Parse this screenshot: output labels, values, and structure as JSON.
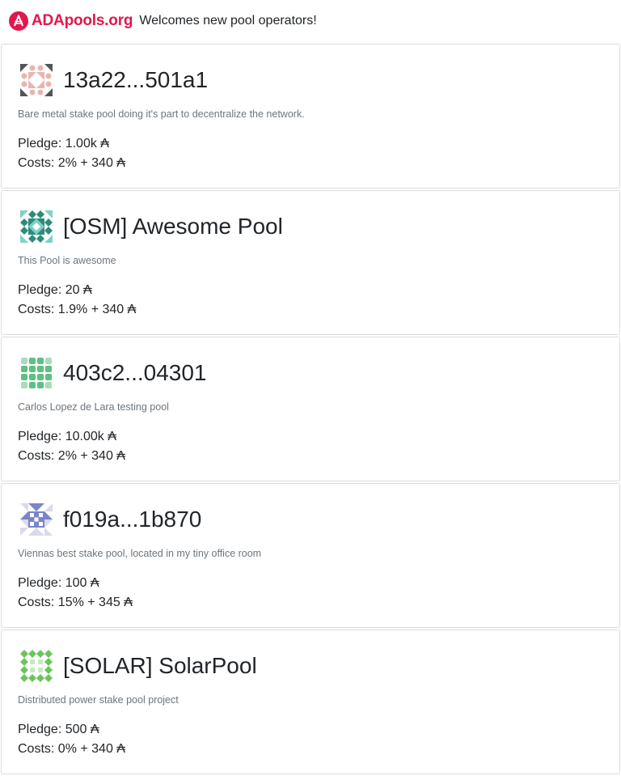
{
  "header": {
    "brand": "ADApools.org",
    "tagline": "Welcomes new pool operators!",
    "brand_color": "#e0184d"
  },
  "pools": [
    {
      "name": "13a22...501a1",
      "description": "Bare metal stake pool doing it's part to decentralize the network.",
      "pledge": "Pledge: 1.00k ₳",
      "costs": "Costs: 2% + 340 ₳",
      "identicon_color": "#e8b5b0",
      "identicon_accent": "#555555"
    },
    {
      "name": "[OSM] Awesome Pool",
      "description": "This Pool is awesome",
      "pledge": "Pledge: 20 ₳",
      "costs": "Costs: 1.9% + 340 ₳",
      "identicon_color": "#2e8a7a",
      "identicon_accent": "#7ed2c4"
    },
    {
      "name": "403c2...04301",
      "description": "Carlos Lopez de Lara testing pool",
      "pledge": "Pledge: 10.00k ₳",
      "costs": "Costs: 2% + 340 ₳",
      "identicon_color": "#5fbf85",
      "identicon_accent": "#a8dcbc"
    },
    {
      "name": "f019a...1b870",
      "description": "Viennas best stake pool, located in my tiny office room",
      "pledge": "Pledge: 100 ₳",
      "costs": "Costs: 15% + 345 ₳",
      "identicon_color": "#7a85cc",
      "identicon_accent": "#d9dbe8"
    },
    {
      "name": "[SOLAR] SolarPool",
      "description": "Distributed power stake pool project",
      "pledge": "Pledge: 500 ₳",
      "costs": "Costs: 0% + 340 ₳",
      "identicon_color": "#6cc55c",
      "identicon_accent": "#c8e9c2"
    }
  ]
}
